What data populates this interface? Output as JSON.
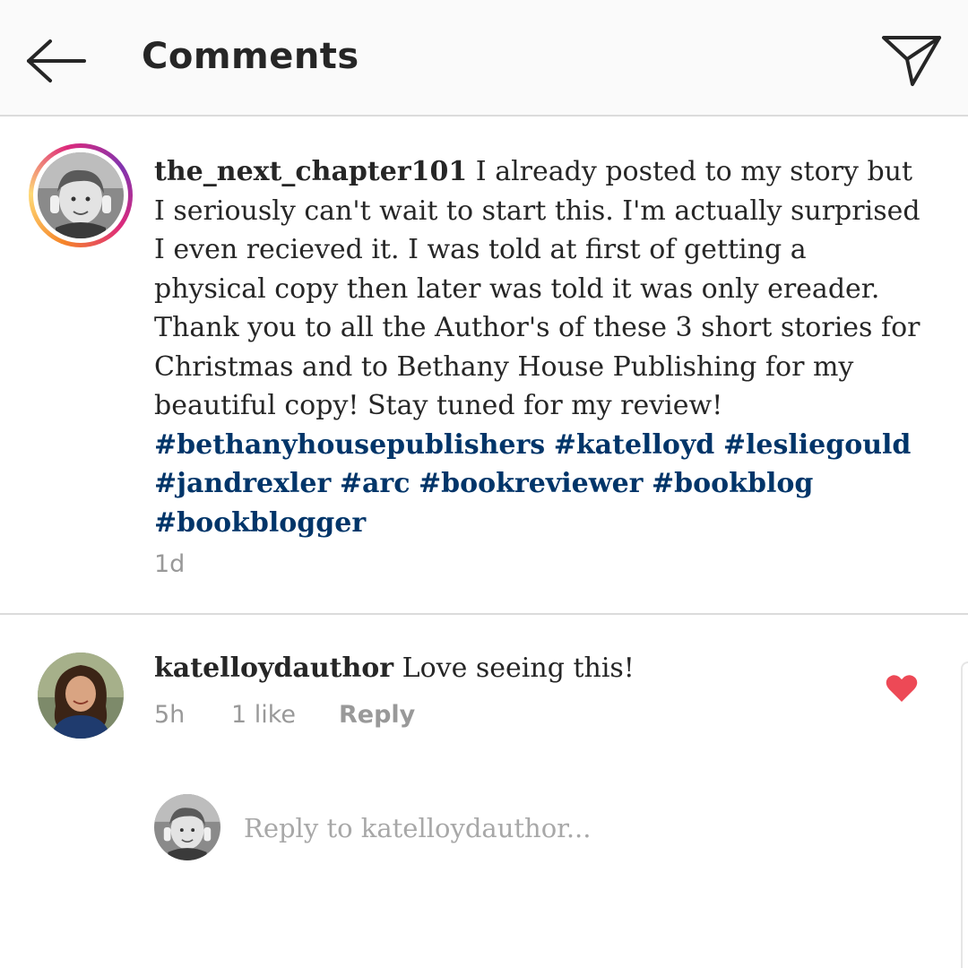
{
  "header": {
    "title": "Comments",
    "back_icon": "arrow-left-icon",
    "send_icon": "paper-plane-icon"
  },
  "caption": {
    "username": "the_next_chapter101",
    "text": " I already posted to my story but I seriously can't wait to start this. I'm actually surprised I even recieved it. I was told at first of getting a physical copy then later was told it was only ereader. Thank you to all the Author's of these 3 short stories for Christmas and to Bethany House Publishing for my beautiful copy! Stay tuned for my review! ",
    "hashtags": [
      "#bethanyhousepublishers",
      "#katelloyd",
      "#lesliegould",
      "#jandrexler",
      "#arc",
      "#bookreviewer",
      "#bookblog",
      "#bookblogger"
    ],
    "time": "1d"
  },
  "comment": {
    "username": "katelloydauthor",
    "text": " Love seeing this!",
    "time": "5h",
    "likes": "1 like",
    "reply_label": "Reply",
    "liked": true
  },
  "reply_box": {
    "placeholder": "Reply to katelloydauthor..."
  },
  "colors": {
    "hashtag": "#003569",
    "heart": "#ed4956",
    "muted": "#999999"
  }
}
